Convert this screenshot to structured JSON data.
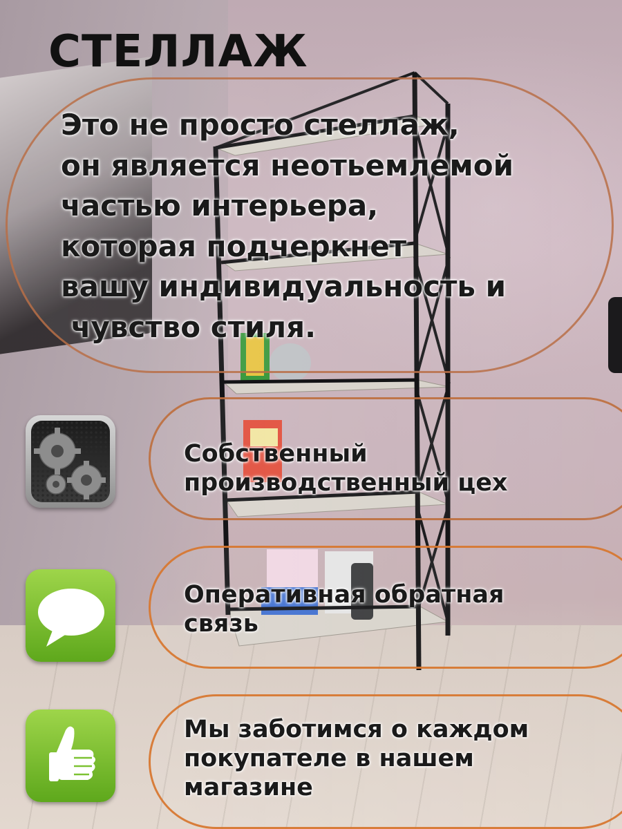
{
  "title": "СТЕЛЛАЖ",
  "intro": {
    "lines": [
      "Это не просто стеллаж,",
      "он является неотьемлемой",
      "частью интерьера,",
      "которая подчеркнет",
      "вашу индивидуальность и",
      " чувство стиля."
    ]
  },
  "features": [
    {
      "icon": "gear-icon",
      "lines": [
        "Собственный",
        "производственный цех"
      ]
    },
    {
      "icon": "speech-bubble-icon",
      "lines": [
        "Оперативная обратная",
        "связь"
      ]
    },
    {
      "icon": "thumbs-up-icon",
      "lines": [
        "Мы заботимся о каждом",
        "покупателе в нашем",
        "магазине"
      ]
    }
  ],
  "colors": {
    "accent_outline": "#c47a3a",
    "icon_green": "#7cc232",
    "text": "#1a1a1a"
  }
}
